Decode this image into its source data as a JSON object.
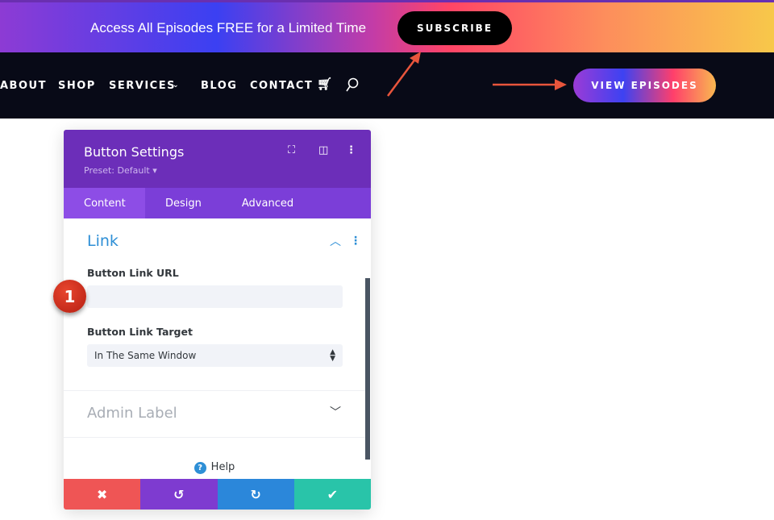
{
  "banner": {
    "text": "Access All Episodes FREE for a Limited Time",
    "subscribe": "SUBSCRIBE"
  },
  "nav": {
    "items": [
      "ABOUT",
      "SHOP",
      "SERVICES",
      "BLOG",
      "CONTACT"
    ],
    "cta": "VIEW EPISODES"
  },
  "panel": {
    "title": "Button Settings",
    "preset": "Preset: Default ▾",
    "tabs": [
      "Content",
      "Design",
      "Advanced"
    ],
    "active_tab": "Content",
    "section": "Link",
    "url_label": "Button Link URL",
    "url_value": "",
    "target_label": "Button Link Target",
    "target_value": "In The Same Window",
    "admin_label": "Admin Label",
    "help": "Help"
  },
  "annotation": {
    "badge": "1"
  },
  "colors": {
    "accent": "#6c2eb9",
    "cancel": "#ef5555",
    "undo": "#7e3bd0",
    "redo": "#2b87da",
    "save": "#29c4a9",
    "arrow": "#e8553c"
  }
}
